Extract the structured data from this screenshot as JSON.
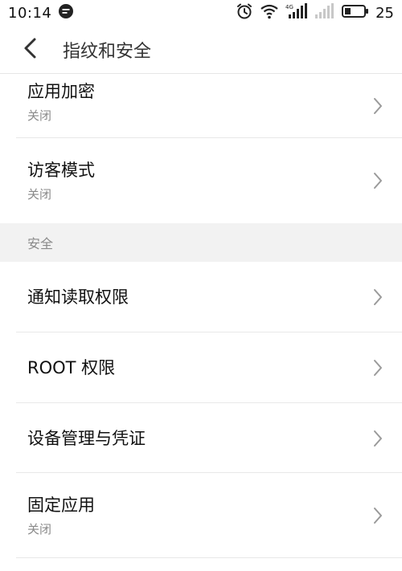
{
  "status_bar": {
    "time": "10:14",
    "battery_level": "25",
    "icons": [
      "message-icon",
      "alarm-icon",
      "wifi-icon",
      "signal-4g-icon",
      "signal-empty-icon",
      "battery-icon"
    ]
  },
  "header": {
    "title": "指纹和安全",
    "back_icon": "back-arrow-icon"
  },
  "rows_top": [
    {
      "title": "应用加密",
      "subtitle": "关闭"
    },
    {
      "title": "访客模式",
      "subtitle": "关闭"
    }
  ],
  "section": {
    "label": "安全"
  },
  "rows_security": [
    {
      "title": "通知读取权限"
    },
    {
      "title": "ROOT 权限"
    },
    {
      "title": "设备管理与凭证"
    },
    {
      "title": "固定应用",
      "subtitle": "关闭"
    }
  ],
  "colors": {
    "section_bg": "#f2f2f2",
    "divider": "#e8e8e8",
    "subtitle": "#8a8a8a",
    "chevron": "#9a9a9a"
  }
}
